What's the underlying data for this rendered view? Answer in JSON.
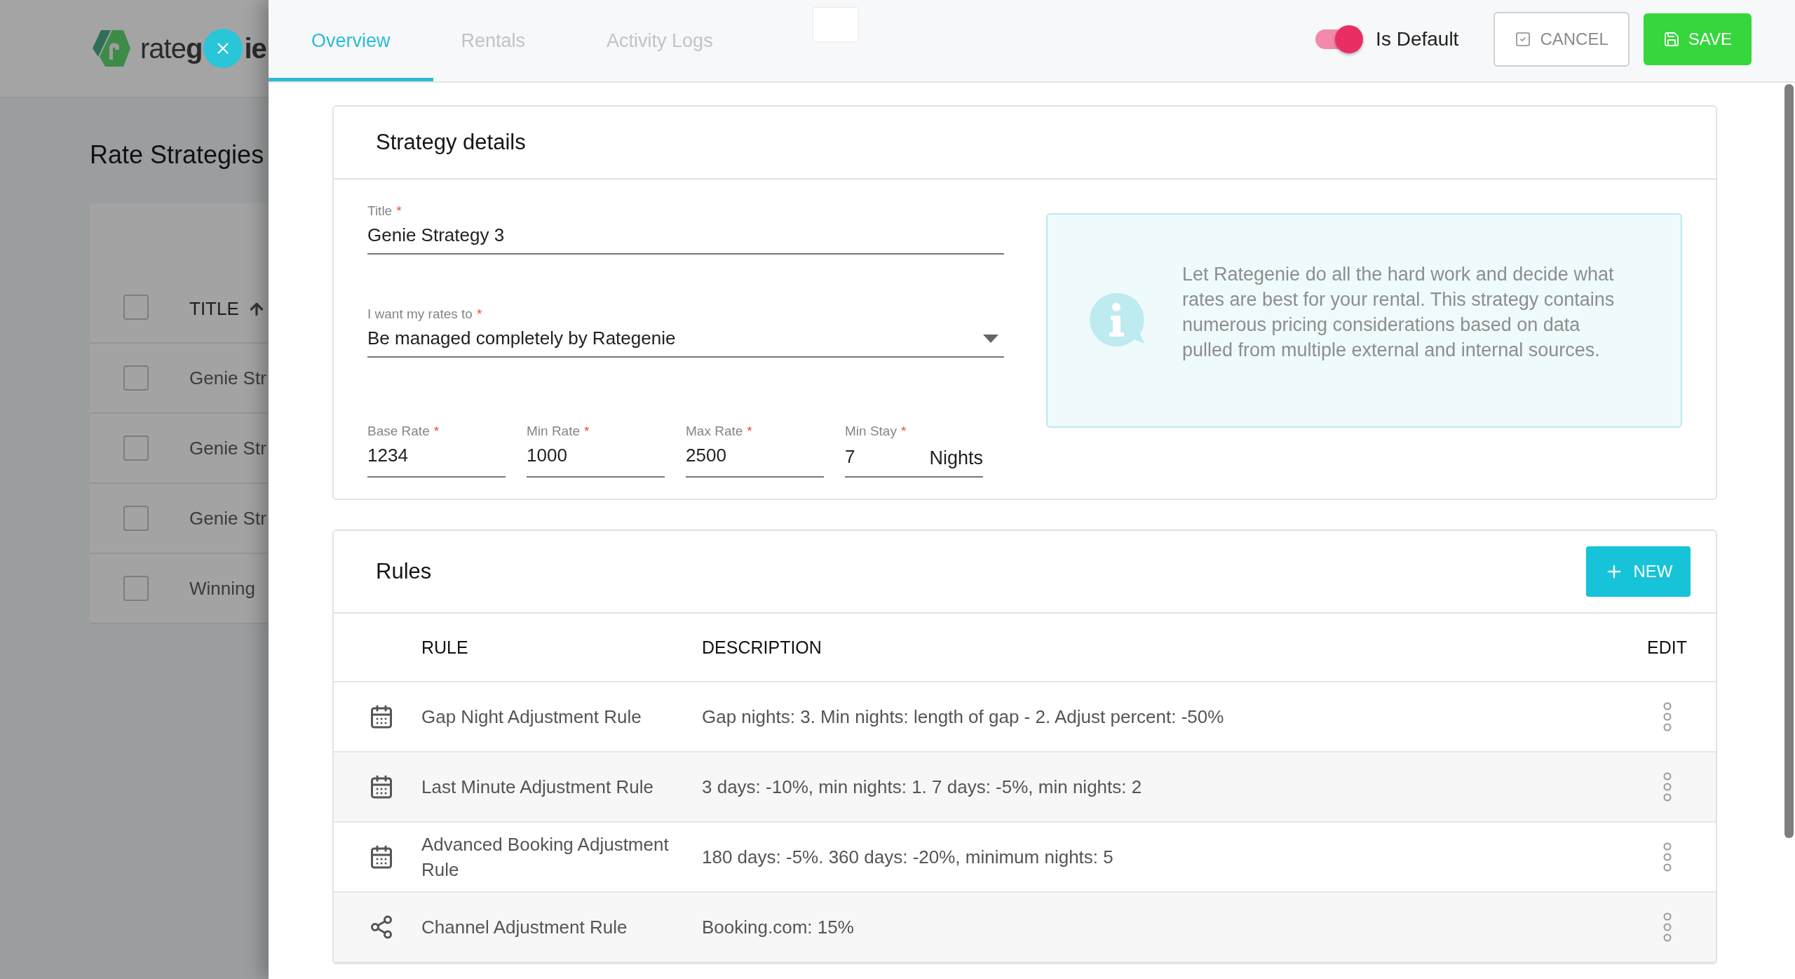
{
  "background_page": {
    "logo": {
      "light": "rate",
      "bold": "g",
      "bold_end": "ie"
    },
    "title": "Rate Strategies",
    "table": {
      "header": {
        "label": "TITLE",
        "checked": false
      },
      "rows": [
        {
          "title": "Genie Str",
          "checked": false
        },
        {
          "title": "Genie Str",
          "checked": false
        },
        {
          "title": "Genie Str",
          "checked": false
        },
        {
          "title": "Winning",
          "checked": false
        }
      ]
    }
  },
  "panel": {
    "tabs": [
      {
        "label": "Overview",
        "selected": true
      },
      {
        "label": "Rentals",
        "selected": false
      },
      {
        "label": "Activity Logs",
        "selected": false
      }
    ],
    "is_default": {
      "label": "Is Default",
      "on": true
    },
    "cancel_button": "CANCEL",
    "save_button": "SAVE"
  },
  "strategy_details": {
    "heading": "Strategy details",
    "title_field": {
      "label": "Title",
      "required": "*",
      "value": "Genie Strategy 3"
    },
    "rates_select": {
      "label": "I want my rates to",
      "required": "*",
      "value": "Be managed completely by Rategenie"
    },
    "rate_fields": [
      {
        "label": "Base Rate",
        "required": "*",
        "value": "1234"
      },
      {
        "label": "Min Rate",
        "required": "*",
        "value": "1000"
      },
      {
        "label": "Max Rate",
        "required": "*",
        "value": "2500"
      },
      {
        "label": "Min Stay",
        "required": "*",
        "value": "7",
        "suffix": "Nights"
      }
    ],
    "info": "Let Rategenie do all the hard work and decide what rates are best for your rental. This strategy contains numerous pricing considerations based on data pulled from multiple external and internal sources."
  },
  "rules": {
    "heading": "Rules",
    "new_button": "NEW",
    "columns": [
      "RULE",
      "DESCRIPTION",
      "EDIT"
    ],
    "rows": [
      {
        "kind": "calendar",
        "rule": "Gap Night Adjustment Rule",
        "description": "Gap nights: 3. Min nights: length of gap - 2. Adjust percent: -50%"
      },
      {
        "kind": "calendar",
        "rule": "Last Minute Adjustment Rule",
        "description": "3 days: -10%, min nights: 1. 7 days: -5%, min nights: 2"
      },
      {
        "kind": "calendar",
        "rule": "Advanced Booking Adjustment Rule",
        "description": "180 days: -5%. 360 days: -20%, minimum nights: 5"
      },
      {
        "kind": "share",
        "rule": "Channel Adjustment Rule",
        "description": "Booking.com: 15%"
      }
    ]
  }
}
